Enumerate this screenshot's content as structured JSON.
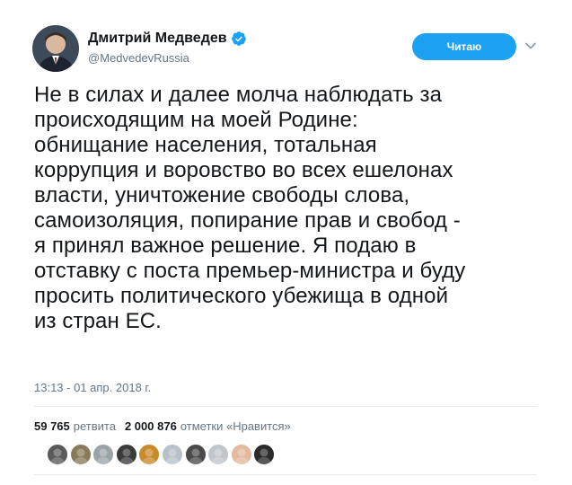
{
  "author": {
    "display_name": "Дмитрий Медведев",
    "handle": "@MedvedevRussia",
    "verified": true,
    "avatar_icon": "user-avatar"
  },
  "follow_button": {
    "label": "Читаю"
  },
  "menu_icon": "chevron-down-icon",
  "tweet": {
    "text": "Не в силах и далее молча наблюдать за\nпроисходящим на моей Родине:\nобнищание населения, тотальная\nкоррупция и воровство во всех ешелонах\nвласти, уничтожение свободы слова,\nсамоизоляция, попирание прав и свобод -\nя принял важное решение. Я подаю в\nотставку с поста премьер-министра и буду\nпросить политического убежища в одной\nиз стран ЕС.",
    "timestamp": "13:13 - 01 апр. 2018 г."
  },
  "stats": {
    "retweets_count": "59 765",
    "retweets_label": "ретвита",
    "likes_count": "2 000 876",
    "likes_label": "отметки «Нравится»"
  },
  "likers": [
    {
      "color": "#5a5a5a"
    },
    {
      "color": "#8a7a5a"
    },
    {
      "color": "#9aa4a8"
    },
    {
      "color": "#3a3a3a"
    },
    {
      "color": "#c98a2a"
    },
    {
      "color": "#b8c0c8"
    },
    {
      "color": "#4a4a4a"
    },
    {
      "color": "#c0c6cc"
    },
    {
      "color": "#e3b9a0"
    },
    {
      "color": "#2a2a2a"
    }
  ],
  "colors": {
    "accent": "#1da1f2",
    "text": "#14171a",
    "muted": "#657786"
  }
}
